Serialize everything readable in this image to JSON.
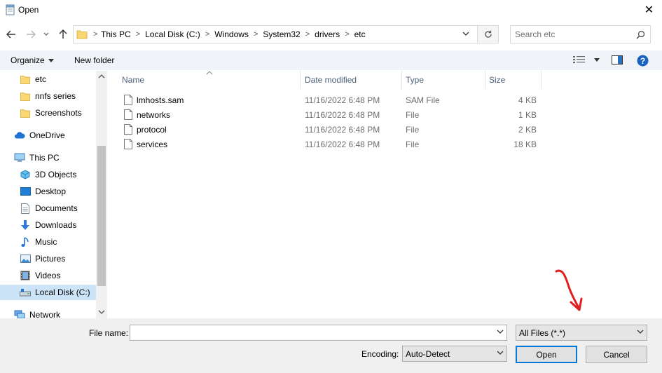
{
  "window": {
    "title": "Open",
    "close_label": "✕"
  },
  "breadcrumb": [
    "This PC",
    "Local Disk (C:)",
    "Windows",
    "System32",
    "drivers",
    "etc"
  ],
  "search": {
    "placeholder": "Search etc"
  },
  "toolbar": {
    "organize_label": "Organize",
    "new_folder_label": "New folder"
  },
  "nav": {
    "items": [
      {
        "label": "etc",
        "icon": "folder-icon"
      },
      {
        "label": "nnfs series",
        "icon": "folder-icon"
      },
      {
        "label": "Screenshots",
        "icon": "folder-icon"
      },
      {
        "label": "OneDrive",
        "icon": "cloud-icon"
      },
      {
        "label": "This PC",
        "icon": "computer-icon"
      },
      {
        "label": "3D Objects",
        "icon": "cube-icon"
      },
      {
        "label": "Desktop",
        "icon": "desktop-icon"
      },
      {
        "label": "Documents",
        "icon": "document-icon"
      },
      {
        "label": "Downloads",
        "icon": "download-icon"
      },
      {
        "label": "Music",
        "icon": "music-icon"
      },
      {
        "label": "Pictures",
        "icon": "pictures-icon"
      },
      {
        "label": "Videos",
        "icon": "videos-icon"
      },
      {
        "label": "Local Disk (C:)",
        "icon": "drive-icon"
      },
      {
        "label": "Network",
        "icon": "network-icon"
      }
    ]
  },
  "columns": {
    "name": "Name",
    "date": "Date modified",
    "type": "Type",
    "size": "Size"
  },
  "files": [
    {
      "name": "lmhosts.sam",
      "date": "11/16/2022 6:48 PM",
      "type": "SAM File",
      "size": "4 KB"
    },
    {
      "name": "networks",
      "date": "11/16/2022 6:48 PM",
      "type": "File",
      "size": "1 KB"
    },
    {
      "name": "protocol",
      "date": "11/16/2022 6:48 PM",
      "type": "File",
      "size": "2 KB"
    },
    {
      "name": "services",
      "date": "11/16/2022 6:48 PM",
      "type": "File",
      "size": "18 KB"
    }
  ],
  "bottom": {
    "file_name_label": "File name:",
    "file_name_value": "",
    "file_type_value": "All Files  (*.*)",
    "encoding_label": "Encoding:",
    "encoding_value": "Auto-Detect",
    "open_label": "Open",
    "cancel_label": "Cancel"
  },
  "colors": {
    "accent": "#0078d7",
    "selection": "#cce4f7",
    "annotation": "#e02020",
    "folder": "#f8d775"
  }
}
